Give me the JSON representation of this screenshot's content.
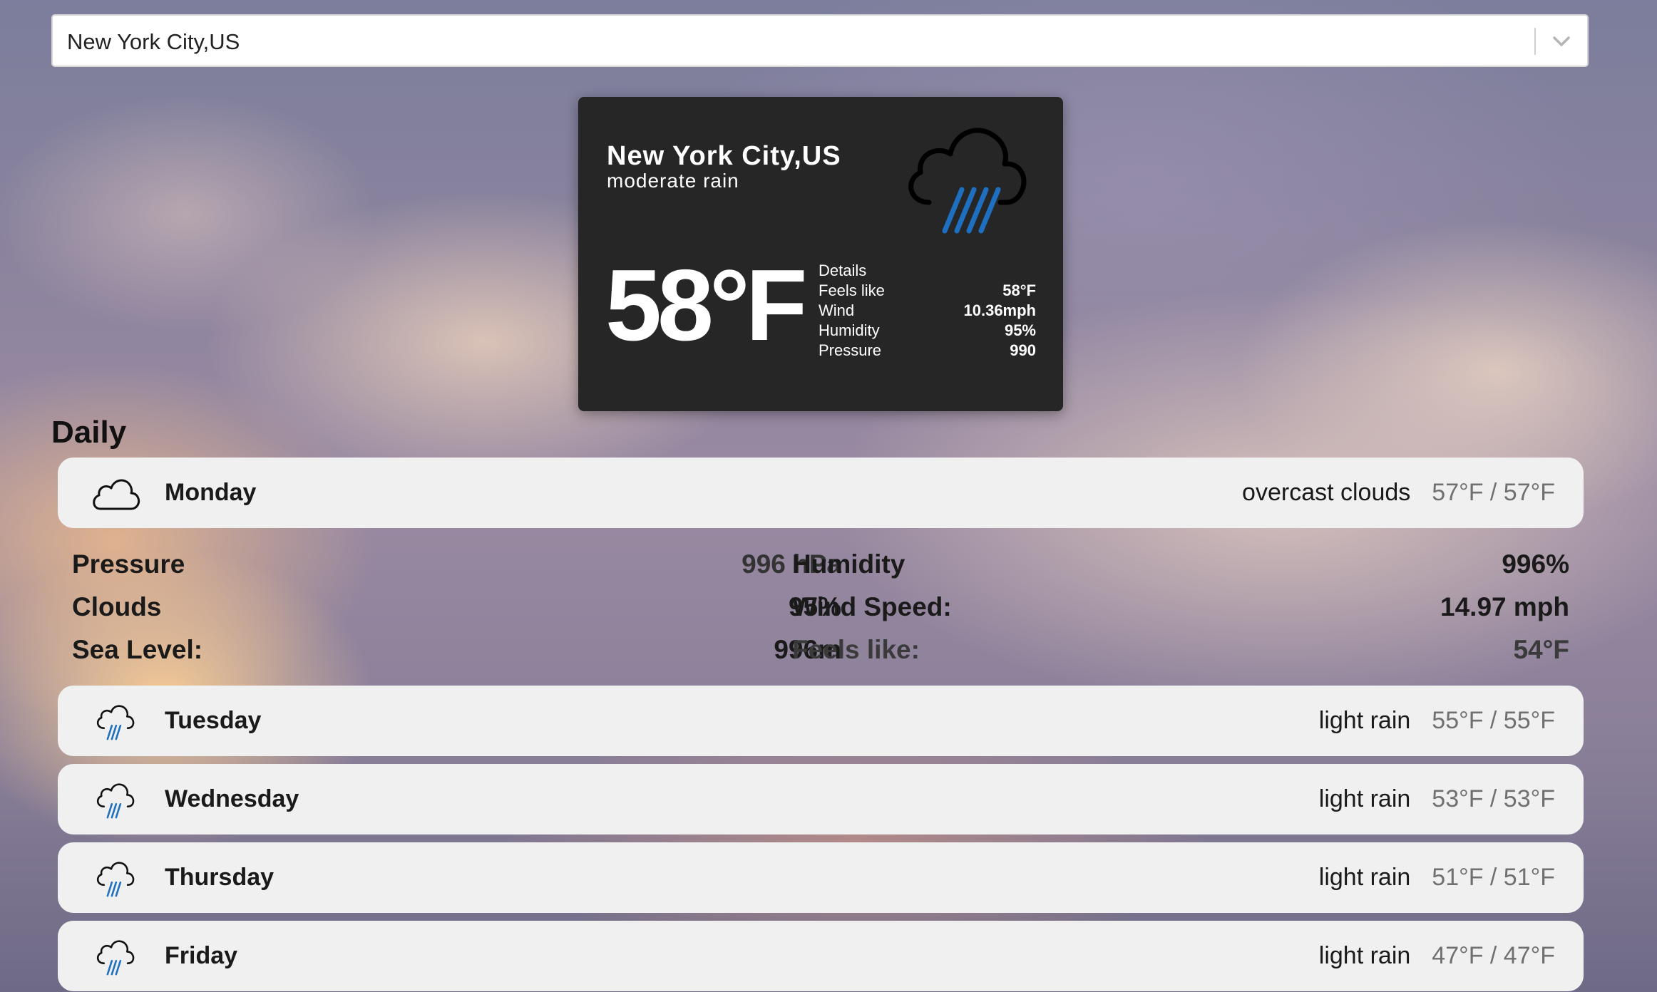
{
  "search": {
    "value": "New York City,US"
  },
  "current": {
    "city": "New York City,US",
    "description": "moderate rain",
    "temperature": "58°F",
    "icon": "rain-cloud-icon",
    "details_title": "Details",
    "details": [
      {
        "label": "Feels like",
        "value": "58°F"
      },
      {
        "label": "Wind",
        "value": "10.36mph"
      },
      {
        "label": "Humidity",
        "value": "95%"
      },
      {
        "label": "Pressure",
        "value": "990"
      }
    ]
  },
  "daily": {
    "title": "Daily",
    "days": [
      {
        "name": "Monday",
        "description": "overcast clouds",
        "temps": "57°F / 57°F",
        "icon": "cloud-icon"
      },
      {
        "name": "Tuesday",
        "description": "light rain",
        "temps": "55°F / 55°F",
        "icon": "rain-cloud-icon"
      },
      {
        "name": "Wednesday",
        "description": "light rain",
        "temps": "53°F / 53°F",
        "icon": "rain-cloud-icon"
      },
      {
        "name": "Thursday",
        "description": "light rain",
        "temps": "51°F / 51°F",
        "icon": "rain-cloud-icon"
      },
      {
        "name": "Friday",
        "description": "light rain",
        "temps": "47°F / 47°F",
        "icon": "rain-cloud-icon"
      }
    ],
    "expanded": {
      "rows": [
        {
          "left_label": "Pressure",
          "left_value": "996 hPa",
          "right_label": "Humidity",
          "right_value": "996%"
        },
        {
          "left_label": "Clouds",
          "left_value": "95%",
          "right_label": "Wind Speed:",
          "right_value": "14.97 mph"
        },
        {
          "left_label": "Sea Level:",
          "left_value": "996m",
          "right_label": "Feels like:",
          "right_value": "54°F"
        }
      ]
    }
  },
  "colors": {
    "card_bg": "#262626",
    "rain_blue": "#1f6fc0",
    "row_bg": "#f0f0f0",
    "temp_gray": "#707070"
  }
}
